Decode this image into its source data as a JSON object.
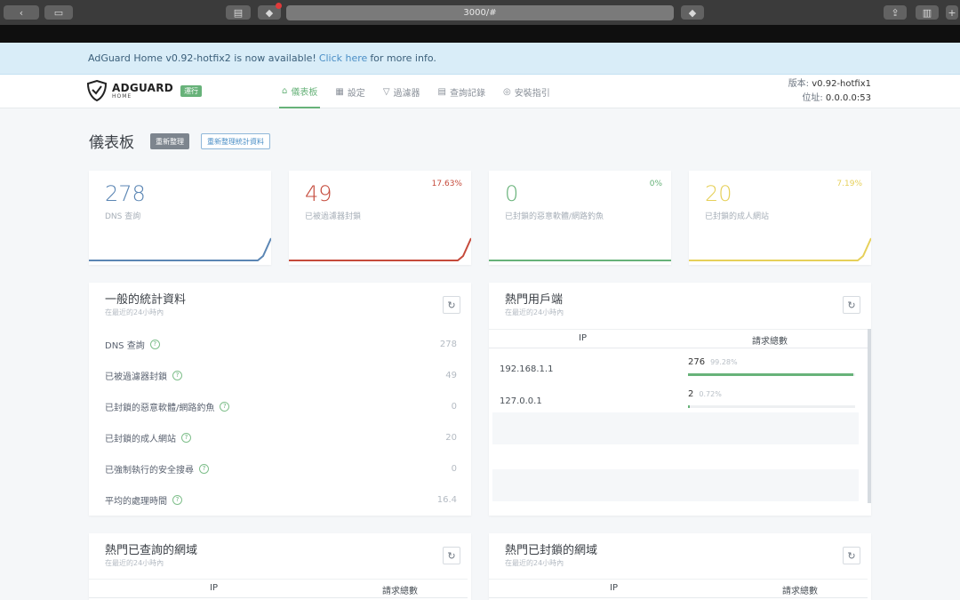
{
  "browser": {
    "url": "3000/#"
  },
  "banner": {
    "text_before": "AdGuard Home v0.92-hotfix2 is now available!",
    "link": "Click here",
    "text_after": "for more info."
  },
  "header": {
    "logo_main": "ADGUARD",
    "logo_sub": "HOME",
    "logo_badge": "運行",
    "nav": [
      {
        "label": "儀表板",
        "icon": "dashboard-icon"
      },
      {
        "label": "設定",
        "icon": "settings-icon"
      },
      {
        "label": "過濾器",
        "icon": "filter-icon"
      },
      {
        "label": "查詢記錄",
        "icon": "log-icon"
      },
      {
        "label": "安裝指引",
        "icon": "setup-icon"
      }
    ],
    "version_label": "版本:",
    "version_value": "v0.92-hotfix1",
    "address_label": "位址:",
    "address_value": "0.0.0.0:53"
  },
  "page": {
    "title": "儀表板",
    "refresh_button": "重新整理",
    "reset_button": "重新整理統計資料"
  },
  "stats": [
    {
      "value": "278",
      "label": "DNS 查詢",
      "pct": "",
      "color": "#5b86b4"
    },
    {
      "value": "49",
      "label": "已被過濾器封鎖",
      "pct": "17.63%",
      "color": "#c54a3b"
    },
    {
      "value": "0",
      "label": "已封鎖的惡意軟體/網路釣魚",
      "pct": "0%",
      "color": "#67b279"
    },
    {
      "value": "20",
      "label": "已封鎖的成人網站",
      "pct": "7.19%",
      "color": "#e6d05a"
    }
  ],
  "general_stats": {
    "title": "一般的統計資料",
    "subtitle": "在最近的24小時內",
    "rows": [
      {
        "label": "DNS 查詢",
        "value": "278"
      },
      {
        "label": "已被過濾器封鎖",
        "value": "49"
      },
      {
        "label": "已封鎖的惡意軟體/網路釣魚",
        "value": "0"
      },
      {
        "label": "已封鎖的成人網站",
        "value": "20"
      },
      {
        "label": "已強制執行的安全搜尋",
        "value": "0"
      },
      {
        "label": "平均的處理時間",
        "value": "16.4"
      }
    ]
  },
  "top_clients": {
    "title": "熱門用戶端",
    "subtitle": "在最近的24小時內",
    "col_ip": "IP",
    "col_count": "請求總數",
    "rows": [
      {
        "ip": "192.168.1.1",
        "count": "276",
        "pct": "99.28%",
        "fraction": 0.99
      },
      {
        "ip": "127.0.0.1",
        "count": "2",
        "pct": "0.72%",
        "fraction": 0.01
      }
    ]
  },
  "top_queried": {
    "title": "熱門已查詢的網域",
    "subtitle": "在最近的24小時內",
    "col_ip": "IP",
    "col_count": "請求總數"
  },
  "top_blocked": {
    "title": "熱門已封鎖的網域",
    "subtitle": "在最近的24小時內",
    "col_ip": "IP",
    "col_count": "請求總數"
  }
}
